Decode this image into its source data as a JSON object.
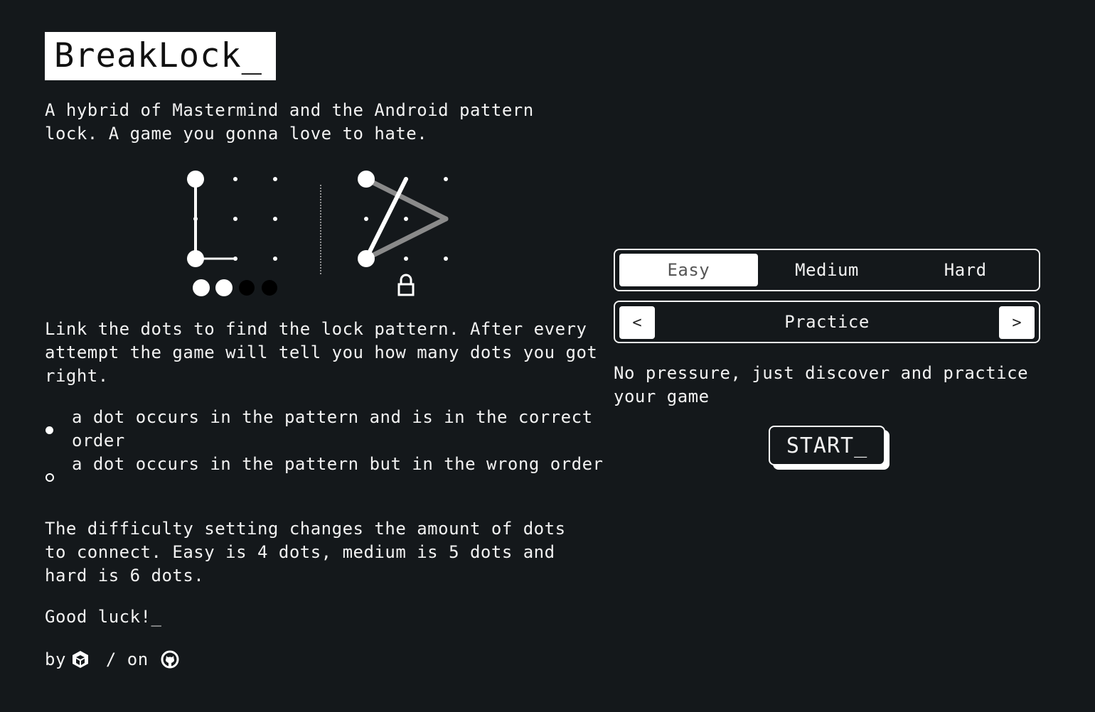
{
  "app": {
    "title": "BreakLock_"
  },
  "intro": "A hybrid of Mastermind and the Android pattern lock. A game you gonna love to hate.",
  "howto": "Link the dots to find the lock pattern. After every attempt the game will tell you how many dots you got right.",
  "legend": [
    {
      "text": "a dot occurs in the pattern and is in the correct order",
      "marker": "filled-dot"
    },
    {
      "text": "a dot occurs in the pattern but in the wrong order",
      "marker": "hollow-dot"
    }
  ],
  "difficulty_note": "The difficulty setting changes the amount of dots to connect. Easy is 4 dots, medium is 5 dots and hard is 6 dots.",
  "good_luck": "Good luck!_",
  "byline": {
    "by": "by",
    "on": "/ on",
    "author_icon": "author-logo-icon",
    "repo_icon": "github-icon"
  },
  "illustration": {
    "attempt_feedback": {
      "correct_order": 2,
      "wrong_order": 0,
      "missing": 2
    },
    "lock_icon": "lock-icon"
  },
  "levels": {
    "options": [
      "Easy",
      "Medium",
      "Hard"
    ],
    "selected": "Easy"
  },
  "mode": {
    "prev_label": "<",
    "label": "Practice",
    "next_label": ">",
    "description": "No pressure, just discover and practice your game"
  },
  "start_label": "START_",
  "colors": {
    "background": "#14181b",
    "foreground": "#f2f2f2",
    "accent": "#ffffff",
    "muted_line": "#8a8a8a"
  }
}
